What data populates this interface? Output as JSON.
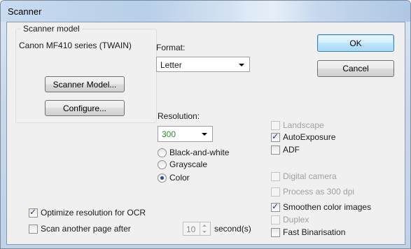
{
  "window": {
    "title": "Scanner"
  },
  "scanner_model": {
    "legend": "Scanner model",
    "name": "Canon MF410 series (TWAIN)",
    "scanner_model_button": "Scanner Model...",
    "configure_button": "Configure..."
  },
  "format": {
    "label": "Format:",
    "value": "Letter"
  },
  "resolution": {
    "label": "Resolution:",
    "value": "300",
    "value_color": "#2e8b2e"
  },
  "color_mode": {
    "options": [
      {
        "label": "Black-and-white",
        "selected": false
      },
      {
        "label": "Grayscale",
        "selected": false
      },
      {
        "label": "Color",
        "selected": true
      }
    ]
  },
  "buttons": {
    "ok": "OK",
    "cancel": "Cancel"
  },
  "options": {
    "landscape": {
      "label": "Landscape",
      "checked": false,
      "enabled": false
    },
    "auto_exposure": {
      "label": "AutoExposure",
      "checked": true,
      "enabled": true
    },
    "adf": {
      "label": "ADF",
      "checked": false,
      "enabled": true
    },
    "digital_camera": {
      "label": "Digital camera",
      "checked": false,
      "enabled": false
    },
    "process_300": {
      "label": "Process as 300 dpi",
      "checked": false,
      "enabled": false
    },
    "smoothen": {
      "label": "Smoothen color images",
      "checked": true,
      "enabled": true
    },
    "duplex": {
      "label": "Duplex",
      "checked": false,
      "enabled": false
    },
    "fast_binarisation": {
      "label": "Fast Binarisation",
      "checked": false,
      "enabled": true
    }
  },
  "bottom": {
    "optimize_ocr": {
      "label": "Optimize resolution for OCR",
      "checked": true
    },
    "scan_another": {
      "label": "Scan another page after",
      "checked": false
    },
    "seconds_value": "10",
    "seconds_label": "second(s)"
  }
}
